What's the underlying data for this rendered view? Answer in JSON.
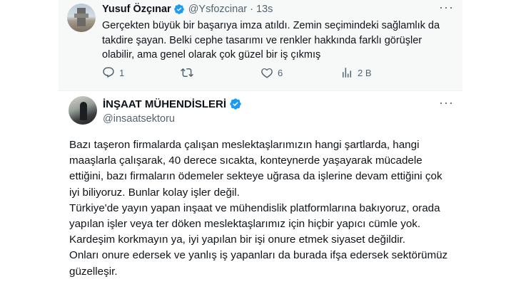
{
  "reply": {
    "author_name": "Yusuf Özçınar",
    "author_handle": "@Ysfozcinar",
    "separator": "·",
    "time": "13s",
    "text": "Gerçekten büyük bir başarıya imza atıldı. Zemin seçimindeki sağlamlık da takdire şayan. Belki cephe tasarımı ve renkler hakkında farklı görüşler olabilir, ama genel olarak çok güzel bir iş çıkmış",
    "actions": {
      "reply_count": "1",
      "retweet_count": "",
      "like_count": "6",
      "views_count": "2 B"
    }
  },
  "main": {
    "author_name": "İNŞAAT MÜHENDİSLERİ",
    "author_handle": "@insaatsektoru",
    "paragraphs": [
      "Bazı taşeron firmalarda çalışan meslektaşlarımızın hangi şartlarda, hangi maaşlarla çalışarak, 40 derece sıcakta, konteynerde yaşayarak mücadele ettiğini, bazı firmaların ödemeler sekteye uğrasa da işlerine devam ettiğini çok iyi biliyoruz. Bunlar kolay işler değil.",
      "Türkiye'de yayın yapan inşaat ve mühendislik platformlarına bakıyoruz, orada yapılan işler veya ter döken meslektaşlarımız için hiçbir yapıcı cümle yok. Kardeşim korkmayın ya, iyi yapılan bir işi onure etmek siyaset değildir.",
      "Onları onure edersek ve  yanlış iş yapanları da burada ifşa edersek sektörümüz güzelleşir."
    ]
  },
  "icons": {
    "verified": "verified-badge-icon",
    "more": "more-dots-icon",
    "reply": "reply-icon",
    "retweet": "retweet-icon",
    "like": "heart-icon",
    "views": "views-chart-icon"
  },
  "colors": {
    "verified_blue": "#1d9bf0",
    "muted_text": "#536471",
    "reply_bg": "#f7f9f9"
  }
}
